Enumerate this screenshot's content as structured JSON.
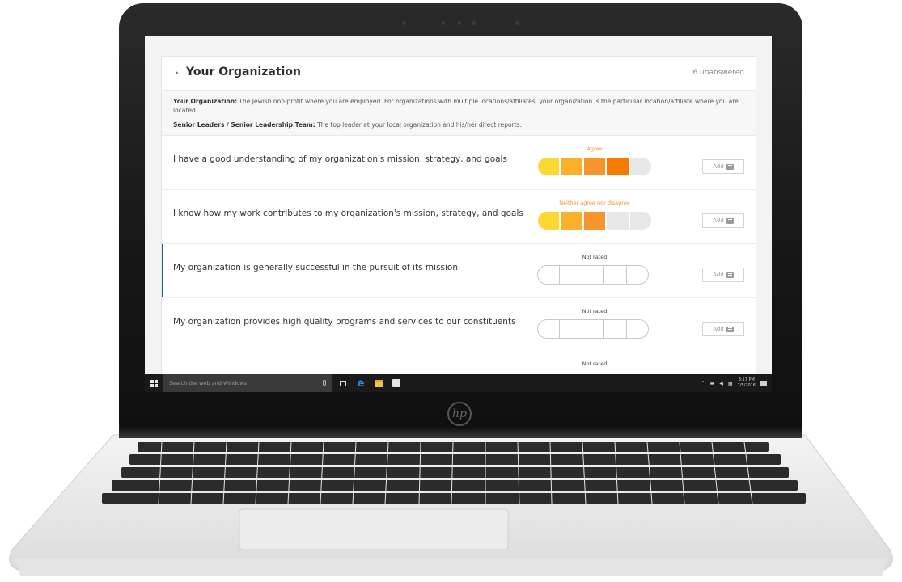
{
  "section": {
    "title": "Your Organization",
    "chevron": "›",
    "unanswered": "6 unanswered"
  },
  "definitions": {
    "org_term": "Your Organization:",
    "org_text": " The Jewish non-profit where you are employed. For organizations with multiple locations/affiliates, your organization is the particular location/affiliate where you are located.",
    "leaders_term": "Senior Leaders / Senior Leadership Team:",
    "leaders_text": " The top leader at your local organization and his/her direct reports."
  },
  "questions": [
    {
      "text": "I have a good understanding of my organization's mission, strategy, and goals",
      "rating_label": "Agree",
      "rating_value": 4,
      "scale_max": 5,
      "add_label": "Add"
    },
    {
      "text": "I know how my work contributes to my organization's mission, strategy, and goals",
      "rating_label": "Neither agree nor disagree",
      "rating_value": 3,
      "scale_max": 5,
      "add_label": "Add"
    },
    {
      "text": "My organization is generally successful in the pursuit of its mission",
      "rating_label": "Not rated",
      "rating_value": 0,
      "scale_max": 5,
      "add_label": "Add"
    },
    {
      "text": "My organization provides high quality programs and services to our constituents",
      "rating_label": "Not rated",
      "rating_value": 0,
      "scale_max": 5,
      "add_label": "Add"
    }
  ],
  "partial_row": {
    "rating_label": "Not rated"
  },
  "rating_colors": [
    "#fdd835",
    "#fbb02a",
    "#f7942b",
    "#f57c00",
    "#e7e7e7"
  ],
  "accent_color": "#21677d",
  "taskbar": {
    "search_placeholder": "Search the web and Windows",
    "edge_glyph": "e",
    "clock_time": "3:17 PM",
    "clock_date": "7/5/2016"
  },
  "brand": {
    "logo_text": "hp"
  },
  "icons": [
    "windows-start-icon",
    "microphone-icon",
    "task-view-icon",
    "edge-browser-icon",
    "file-explorer-icon",
    "store-icon",
    "chevron-right-icon",
    "comment-icon",
    "notification-icon"
  ]
}
